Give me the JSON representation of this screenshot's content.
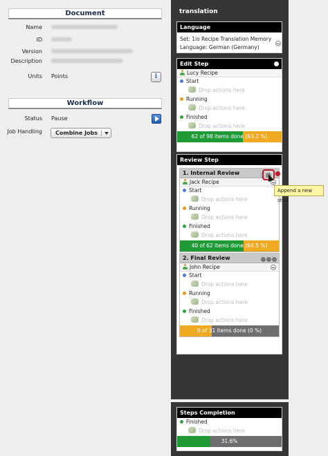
{
  "document": {
    "header": "Document",
    "fields": [
      {
        "label": "Name",
        "value": ""
      },
      {
        "label": "ID",
        "value": ""
      },
      {
        "label": "Version",
        "value": ""
      },
      {
        "label": "Description",
        "value": ""
      },
      {
        "label": "Units",
        "value": "Points"
      }
    ]
  },
  "workflow": {
    "header": "Workflow",
    "status_label": "Status",
    "status_value": "Pause",
    "job_handling_label": "Job Handling",
    "job_handling_value": "Combine Jobs"
  },
  "translation": {
    "title": "translation",
    "language": {
      "header": "Language",
      "set_line": "Set: 1io Recipe Translation Memory",
      "language_line": "Language: German (Germany)"
    },
    "edit_step": {
      "header": "Edit Step",
      "user": "Lucy Recipe",
      "start": "Start",
      "running": "Running",
      "finished": "Finished",
      "drop": "Drop actions here",
      "progress_text": "62 of 98 items done (63.2 %)",
      "progress_fraction": 0.632
    },
    "review_step": {
      "header": "Review Step",
      "internal": {
        "title": "1. Internal Review",
        "user": "Jack Recipe",
        "start": "Start",
        "running": "Running",
        "finished": "Finished",
        "drop": "Drop actions here",
        "progress_text": "40 of 62 items done (64.5 %)",
        "progress_fraction": 0.645
      },
      "final": {
        "title": "2. Final Review",
        "user": "John Recipe",
        "start": "Start",
        "running": "Running",
        "finished": "Finished",
        "drop": "Drop actions here",
        "progress_text": "0 of 31 items done (0 %)",
        "progress_fraction": 0.0
      }
    },
    "tooltip": "Append a new step",
    "steps_completion": {
      "header": "Steps Completion",
      "finished": "Finished",
      "drop": "Drop actions here",
      "progress_text": "31.6%",
      "progress_fraction": 0.316
    }
  },
  "colors": {
    "green": "#1f9a36",
    "orange": "#f0a922",
    "gray": "#6e6e6e",
    "dark_panel": "#363636"
  }
}
